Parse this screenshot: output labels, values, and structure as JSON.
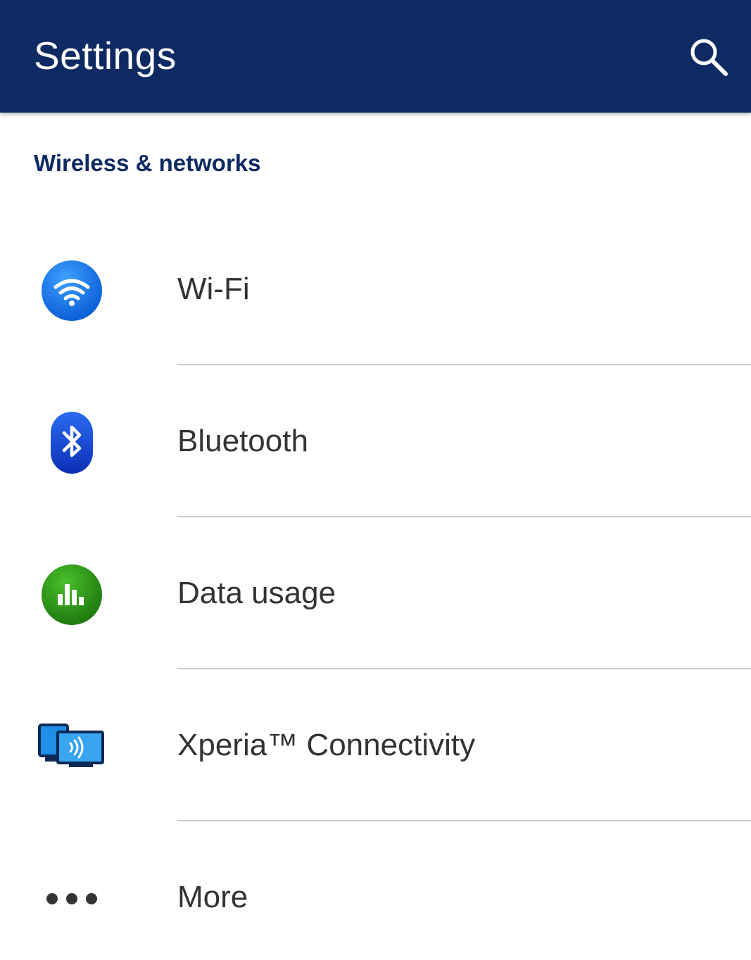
{
  "toolbar": {
    "title": "Settings",
    "search_icon": "search-icon",
    "background": "#0d2a63"
  },
  "section": {
    "header": "Wireless & networks",
    "color": "#0d2a63"
  },
  "items": [
    {
      "label": "Wi-Fi",
      "icon": "wifi-icon",
      "color": "#1a73e8"
    },
    {
      "label": "Bluetooth",
      "icon": "bluetooth-icon",
      "color": "#1446c8"
    },
    {
      "label": "Data usage",
      "icon": "data-usage-icon",
      "color": "#2e9a1a"
    },
    {
      "label": "Xperia™ Connectivity",
      "icon": "xperia-connectivity-icon",
      "color": "#1e8ee8"
    },
    {
      "label": "More",
      "icon": "more-dots-icon",
      "color": "#333333"
    }
  ]
}
